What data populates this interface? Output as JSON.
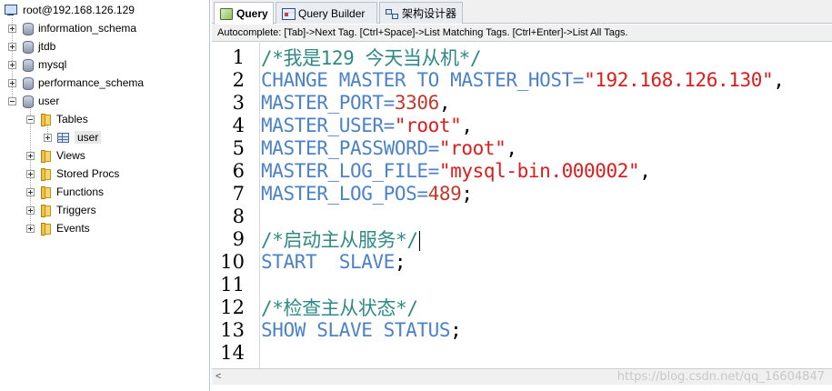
{
  "tree": {
    "root_label": "root@192.168.126.129",
    "databases": [
      {
        "label": "information_schema"
      },
      {
        "label": "jtdb"
      },
      {
        "label": "mysql"
      },
      {
        "label": "performance_schema"
      },
      {
        "label": "user"
      }
    ],
    "user_children": {
      "tables_label": "Tables",
      "table_item": "user",
      "views_label": "Views",
      "stored_procs_label": "Stored Procs",
      "functions_label": "Functions",
      "triggers_label": "Triggers",
      "events_label": "Events"
    }
  },
  "tabs": [
    {
      "label": "Query",
      "active": true
    },
    {
      "label": "Query Builder",
      "active": false
    },
    {
      "label": "架构设计器",
      "active": false
    }
  ],
  "autocomplete_hint": "Autocomplete: [Tab]->Next Tag. [Ctrl+Space]->List Matching Tags. [Ctrl+Enter]->List All Tags.",
  "editor": {
    "line_numbers": [
      "1",
      "2",
      "3",
      "4",
      "5",
      "6",
      "7",
      "8",
      "9",
      "10",
      "11",
      "12",
      "13",
      "14"
    ],
    "lines": [
      {
        "t": "comment",
        "text": "/*我是129 今天当从机*/"
      },
      {
        "t": "code",
        "kw": "CHANGE MASTER TO MASTER_HOST=",
        "str": "\"192.168.126.130\"",
        "tail": ","
      },
      {
        "t": "code",
        "kw": "MASTER_PORT=",
        "num": "3306",
        "tail": ","
      },
      {
        "t": "code",
        "kw": "MASTER_USER=",
        "str": "\"root\"",
        "tail": ","
      },
      {
        "t": "code",
        "kw": "MASTER_PASSWORD=",
        "str": "\"root\"",
        "tail": ","
      },
      {
        "t": "code",
        "kw": "MASTER_LOG_FILE=",
        "str": "\"mysql-bin.000002\"",
        "tail": ","
      },
      {
        "t": "code",
        "kw": "MASTER_LOG_POS=",
        "num": "489",
        "tail": ";"
      },
      {
        "t": "blank"
      },
      {
        "t": "comment",
        "text": "/*启动主从服务*/"
      },
      {
        "t": "code",
        "kw": "START  SLAVE",
        "tail": ";"
      },
      {
        "t": "blank"
      },
      {
        "t": "comment",
        "text": "/*检查主从状态*/"
      },
      {
        "t": "code",
        "kw": "SHOW SLAVE STATUS",
        "tail": ";"
      },
      {
        "t": "blank"
      }
    ]
  },
  "scrollbar": {
    "left_arrow": "<"
  },
  "watermark": "https://blog.csdn.net/qq_16604847",
  "colors": {
    "keyword": "#4b82c8",
    "comment": "#2f8a86",
    "string": "#e01b1b",
    "number": "#c0392b"
  }
}
